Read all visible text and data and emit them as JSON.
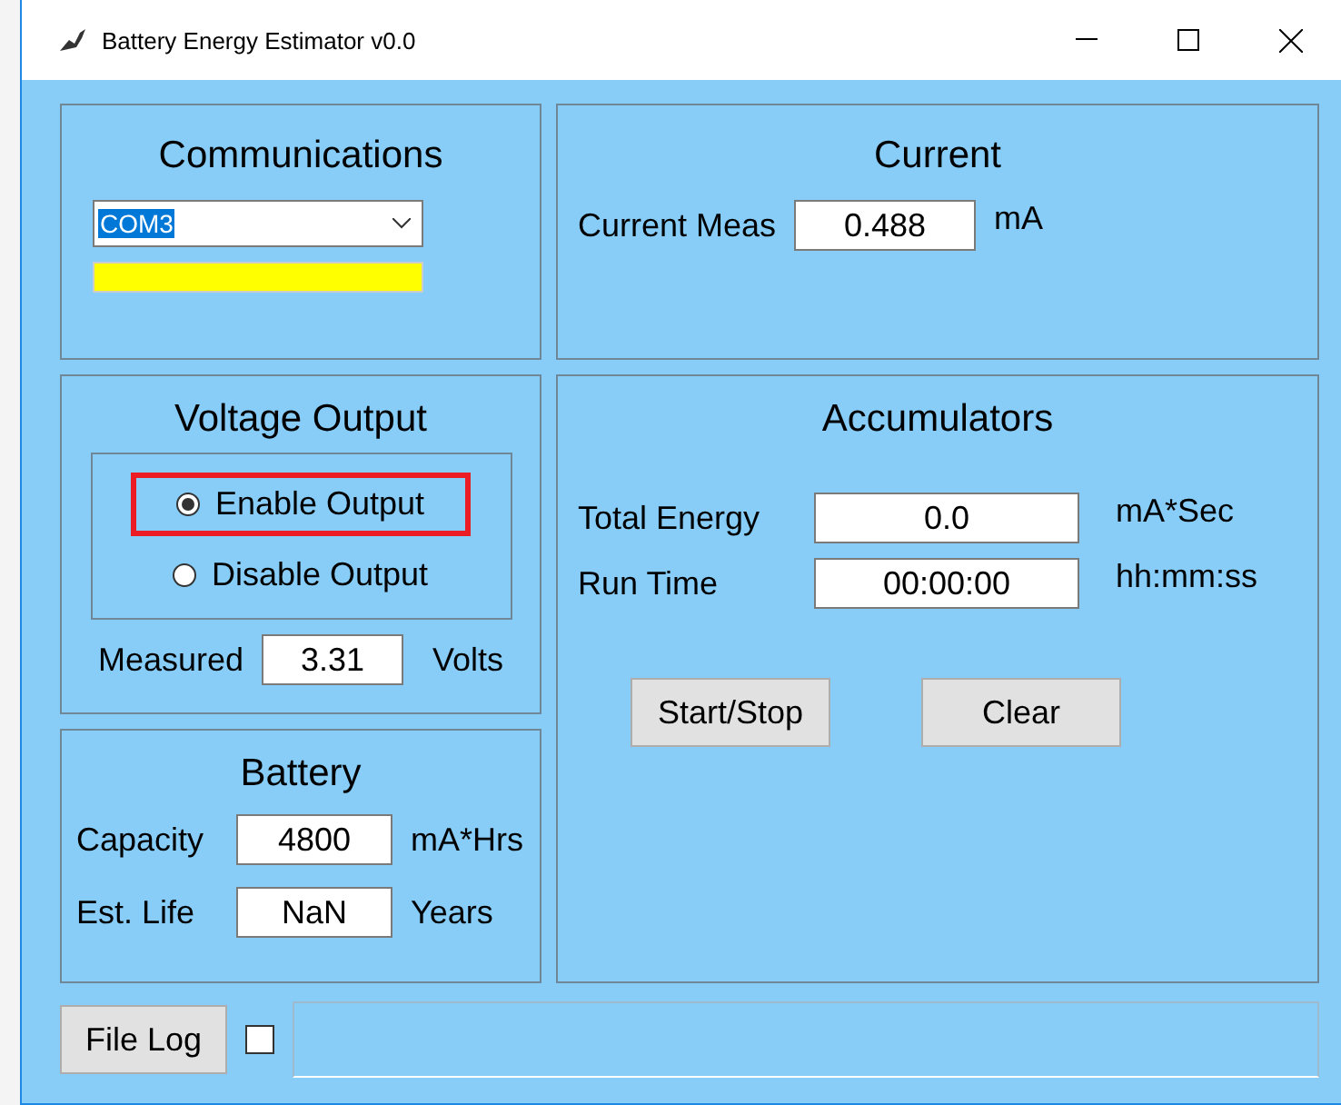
{
  "window": {
    "title": "Battery Energy Estimator v0.0"
  },
  "communications": {
    "title": "Communications",
    "port": "COM3",
    "indicator": {
      "color": "#ffff00"
    }
  },
  "current": {
    "title": "Current",
    "label": "Current Meas",
    "value": "0.488",
    "unit": "mA"
  },
  "voltage_output": {
    "title": "Voltage Output",
    "options": [
      {
        "label": "Enable Output",
        "selected": true,
        "highlighted": true
      },
      {
        "label": "Disable Output",
        "selected": false,
        "highlighted": false
      }
    ],
    "measured": {
      "label": "Measured",
      "value": "3.31",
      "unit": "Volts"
    }
  },
  "accumulators": {
    "title": "Accumulators",
    "fields": [
      {
        "label": "Total Energy",
        "value": "0.0",
        "unit": "mA*Sec"
      },
      {
        "label": "Run Time",
        "value": "00:00:00",
        "unit": "hh:mm:ss"
      }
    ],
    "buttons": [
      "Start/Stop",
      "Clear"
    ]
  },
  "battery": {
    "title": "Battery",
    "fields": [
      {
        "label": "Capacity",
        "value": "4800",
        "unit": "mA*Hrs"
      },
      {
        "label": "Est. Life",
        "value": "NaN",
        "unit": "Years"
      }
    ]
  },
  "footer": {
    "button": "File Log",
    "log_checked": false
  }
}
